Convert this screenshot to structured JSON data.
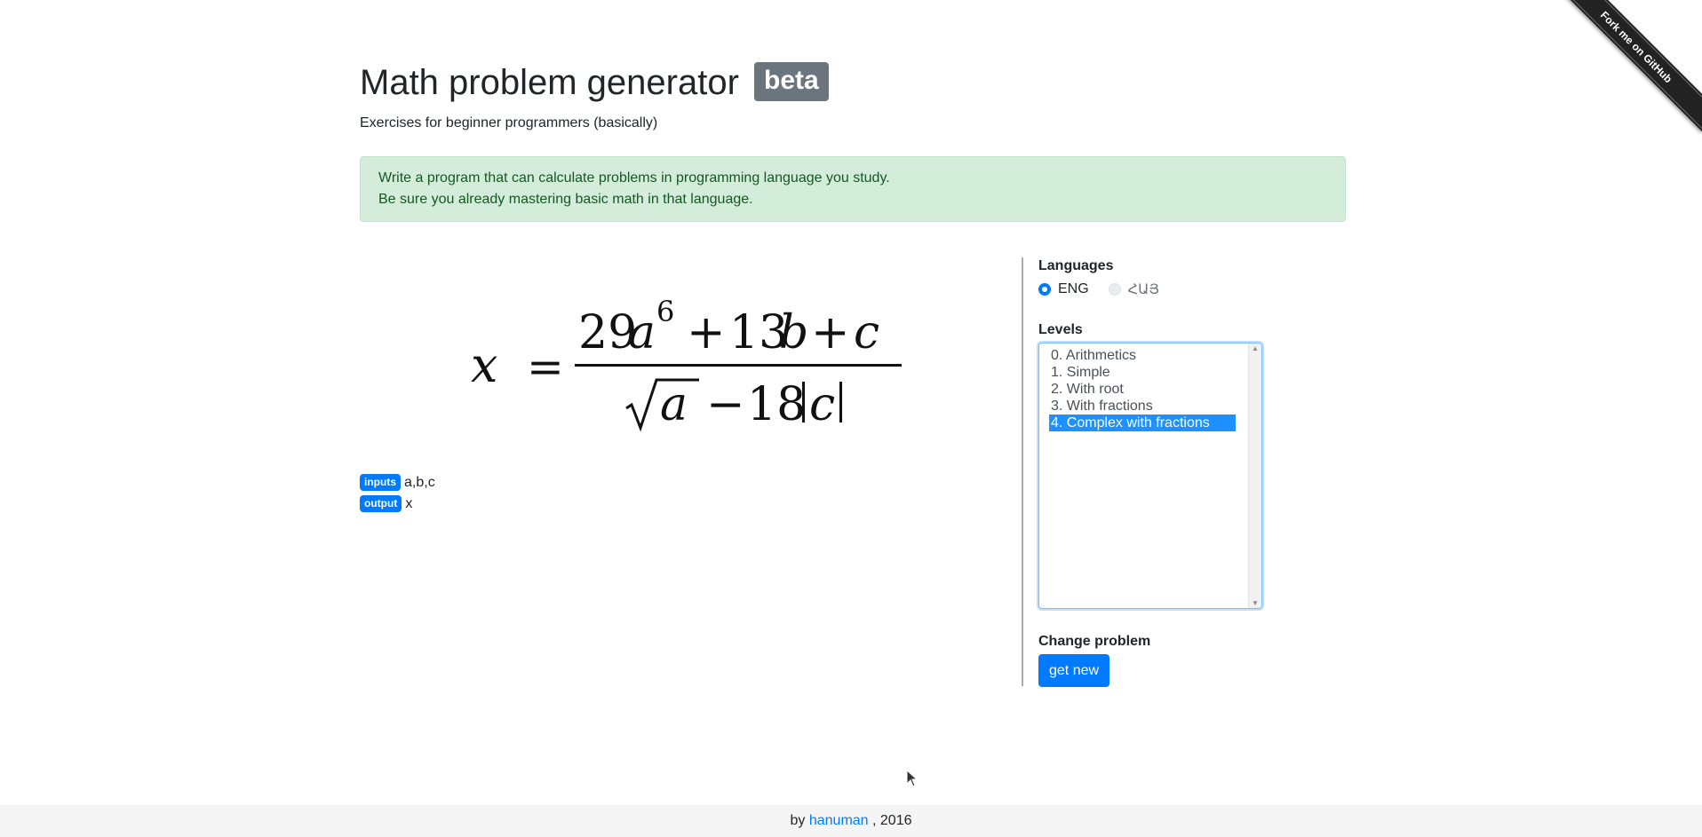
{
  "ribbon": {
    "label": "Fork me on GitHub"
  },
  "header": {
    "title": "Math problem generator",
    "badge": "beta",
    "subtitle": "Exercises for beginner programmers (basically)"
  },
  "alert": {
    "line1": "Write a program that can calculate problems in programming language you study.",
    "line2": "Be sure you already mastering basic math in that language."
  },
  "problem": {
    "formula_text": "x = (29a^6 + 13b + c) / (√a − 18|c|)",
    "inputs_label": "inputs",
    "inputs_value": "a,b,c",
    "output_label": "output",
    "output_value": "x"
  },
  "sidebar": {
    "languages_label": "Languages",
    "languages": [
      {
        "label": "ENG",
        "selected": true,
        "disabled": false
      },
      {
        "label": "ՀԱՅ",
        "selected": false,
        "disabled": true
      }
    ],
    "levels_label": "Levels",
    "levels": [
      "0. Arithmetics",
      "1. Simple",
      "2. With root",
      "3. With fractions",
      "4. Complex with fractions"
    ],
    "selected_level": "4. Complex with fractions",
    "change_label": "Change problem",
    "button_label": "get new"
  },
  "footer": {
    "prefix": "by",
    "author": "hanuman",
    "suffix": ", 2016"
  },
  "colors": {
    "primary": "#007bff",
    "alert_bg": "#d4edda",
    "alert_text": "#155724",
    "badge_gray": "#6c757d",
    "selected_item": "#1e90ff"
  }
}
